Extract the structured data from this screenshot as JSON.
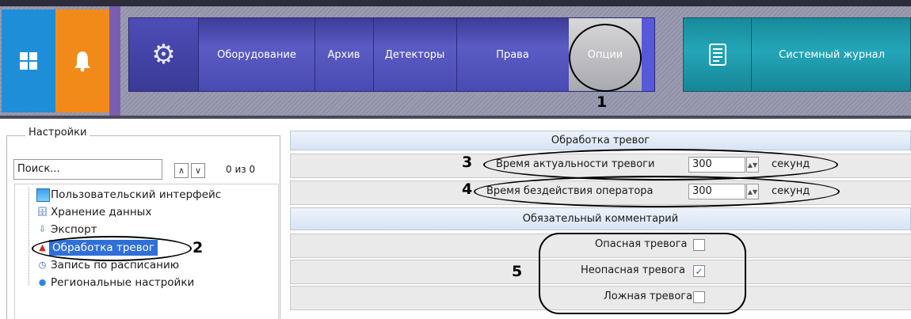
{
  "toolbar": {
    "nav_items": [
      "Оборудование",
      "Архив",
      "Детекторы",
      "Права",
      "Опции"
    ],
    "journal_label": "Системный журнал"
  },
  "left_panel": {
    "legend": "Настройки",
    "search_placeholder": "Поиск...",
    "nav_count": "0 из 0",
    "tree": [
      "Пользовательский интерфейс",
      "Хранение данных",
      "Экспорт",
      "Обработка тревог",
      "Запись по расписанию",
      "Региональные настройки"
    ],
    "selected_index": 3
  },
  "alarm_section": {
    "title": "Обработка тревог",
    "rows": [
      {
        "label": "Время актуальности тревоги",
        "value": "300",
        "unit": "секунд"
      },
      {
        "label": "Время бездействия оператора",
        "value": "300",
        "unit": "секунд"
      }
    ]
  },
  "comment_section": {
    "title": "Обязательный комментарий",
    "rows": [
      {
        "label": "Опасная тревога",
        "checked": false
      },
      {
        "label": "Неопасная тревога",
        "checked": true
      },
      {
        "label": "Ложная тревога",
        "checked": false
      }
    ]
  },
  "annotations": [
    "1",
    "2",
    "3",
    "4",
    "5"
  ],
  "colors": {
    "tile_blue": "#1e8ed8",
    "tile_orange": "#f28a1a",
    "nav_purple": "#5b5bc4",
    "journal_teal": "#23a6b8",
    "selection": "#2f6fd8"
  }
}
